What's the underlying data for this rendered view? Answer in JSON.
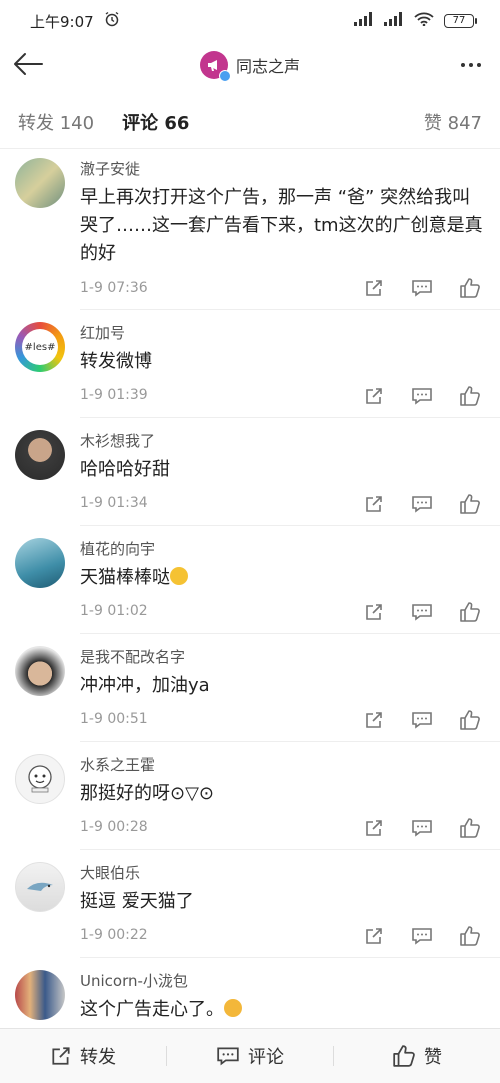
{
  "status_bar": {
    "time": "上午9:07",
    "battery": "77"
  },
  "nav": {
    "title": "同志之声"
  },
  "tabs": {
    "repost": "转发 140",
    "comments": "评论 66",
    "likes": "赞 847"
  },
  "comments": [
    {
      "username": "澈子安徙",
      "text": "早上再次打开这个广告，那一声 “爸” 突然给我叫哭了……这一套广告看下来，tm这次的广创意是真的好",
      "time": "1-9 07:36"
    },
    {
      "username": "红加号",
      "avatar_text": "#les#",
      "text": "转发微博",
      "time": "1-9 01:39"
    },
    {
      "username": "木衫想我了",
      "text": "哈哈哈好甜",
      "time": "1-9 01:34"
    },
    {
      "username": "植花的向宇",
      "text": "天猫棒棒哒",
      "time": "1-9 01:02"
    },
    {
      "username": "是我不配改名字",
      "text": "冲冲冲，加油ya",
      "time": "1-9 00:51"
    },
    {
      "username": "水系之王霍",
      "text": "那挺好的呀⊙▽⊙",
      "time": "1-9 00:28"
    },
    {
      "username": "大眼伯乐",
      "text": "挺逗 爱天猫了",
      "time": "1-9 00:22"
    },
    {
      "username": "Unicorn-小泷包",
      "text": "这个广告走心了。",
      "time": ""
    }
  ],
  "bottom_bar": {
    "repost": "转发",
    "comment": "评论",
    "like": "赞"
  },
  "colors": {
    "background": "#ffffff",
    "text": "#222222",
    "secondary": "#999999",
    "accent_avatar": "#c2368e",
    "verified_blue": "#4a9ff0"
  }
}
